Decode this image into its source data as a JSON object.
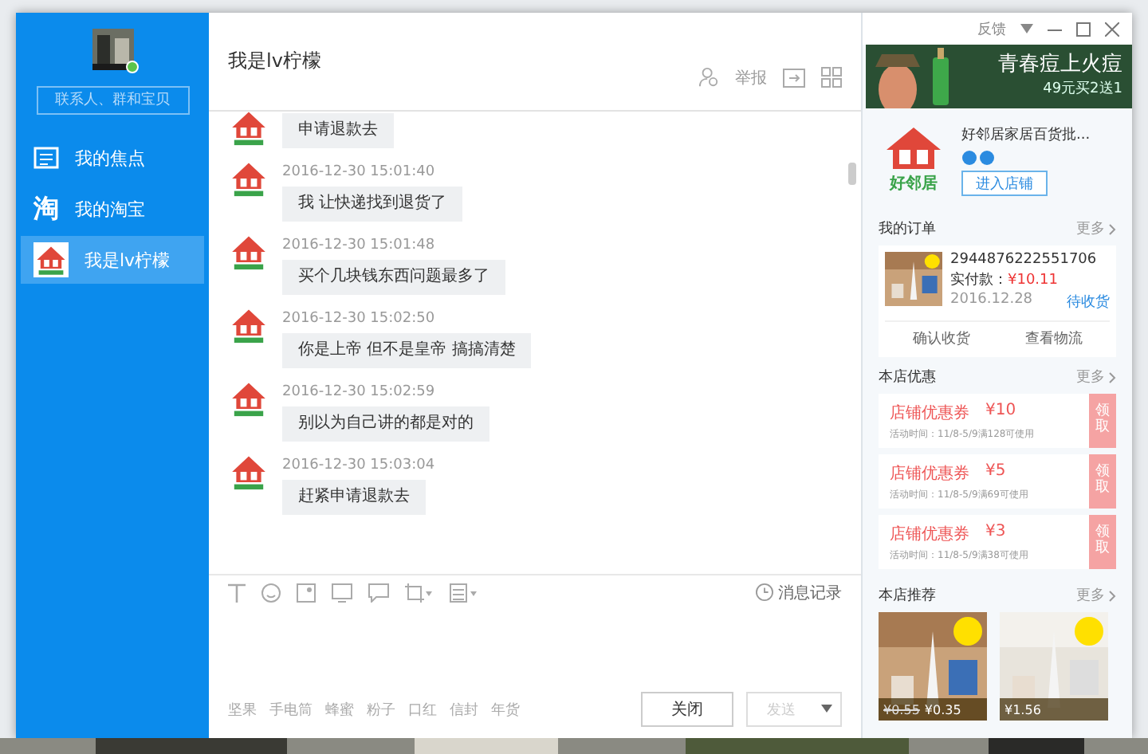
{
  "sidebar": {
    "online": true,
    "search": {
      "placeholder": "联系人、群和宝贝"
    },
    "items": [
      {
        "kind": "focus",
        "label": "我的焦点",
        "selected": false
      },
      {
        "kind": "taobao",
        "icon_text": "淘",
        "label": "我的淘宝",
        "selected": false
      },
      {
        "kind": "shop",
        "label": "我是lv柠檬",
        "selected": true
      }
    ]
  },
  "chat": {
    "title": "我是lv柠檬",
    "actions": [
      "举报"
    ],
    "messages": [
      {
        "text": "申请退款去"
      },
      {
        "time": "2016-12-30 15:01:40",
        "text": "我 让快递找到退货了"
      },
      {
        "time": "2016-12-30 15:01:48",
        "text": "买个几块钱东西问题最多了"
      },
      {
        "time": "2016-12-30 15:02:50",
        "text": "你是上帝 但不是皇帝 搞搞清楚"
      },
      {
        "time": "2016-12-30 15:02:59",
        "text": "别以为自己讲的都是对的"
      },
      {
        "time": "2016-12-30 15:03:04",
        "text": "赶紧申请退款去"
      }
    ],
    "history": "消息记录",
    "quick_words": [
      "坚果",
      "手电筒",
      "蜂蜜",
      "粉子",
      "口红",
      "信封",
      "年货"
    ],
    "close_button": "关闭",
    "send_button": "发送"
  },
  "titlebar": {
    "feedback": "反馈"
  },
  "ad": {
    "headline": "青春痘上火痘",
    "offer": "49元买2送1"
  },
  "shop": {
    "logo_text": "好邻居",
    "name": "好邻居家居百货批...",
    "enter_button": "进入店铺"
  },
  "orders": {
    "title": "我的订单",
    "more": "更多",
    "number": "2944876222551706",
    "paid_label": "实付款：",
    "paid": "¥10.11",
    "date": "2016.12.28",
    "status": "待收货",
    "actions": [
      "确认收货",
      "查看物流"
    ]
  },
  "coupons": {
    "title": "本店优惠",
    "more": "更多",
    "items": [
      {
        "name": "店铺优惠券",
        "amount": "¥10",
        "terms": "活动时间：11/8-5/9满128可使用",
        "claim": "领取"
      },
      {
        "name": "店铺优惠券",
        "amount": "¥5",
        "terms": "活动时间：11/8-5/9满69可使用",
        "claim": "领取"
      },
      {
        "name": "店铺优惠券",
        "amount": "¥3",
        "terms": "活动时间：11/8-5/9满38可使用",
        "claim": "领取"
      }
    ]
  },
  "recommend": {
    "title": "本店推荐",
    "more": "更多",
    "items": [
      {
        "old_price": "¥0.55",
        "price": "¥0.35"
      },
      {
        "price": "¥1.56"
      }
    ]
  }
}
